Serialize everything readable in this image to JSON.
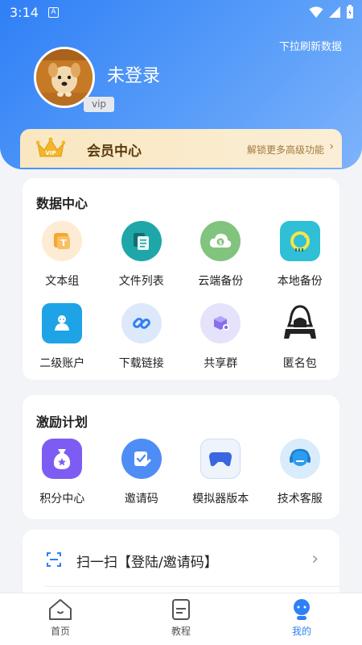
{
  "status": {
    "time": "3:14",
    "notify": "A"
  },
  "header": {
    "refresh_hint": "下拉刷新数据",
    "username": "未登录",
    "vip_tag": "vip"
  },
  "member": {
    "crown_text": "VIP",
    "title": "会员中心",
    "subtitle": "解锁更多高级功能",
    "chevron": "›"
  },
  "data_center": {
    "title": "数据中心",
    "items": [
      {
        "label": "文本组",
        "icon": "text-group-icon"
      },
      {
        "label": "文件列表",
        "icon": "file-list-icon"
      },
      {
        "label": "云端备份",
        "icon": "cloud-backup-icon"
      },
      {
        "label": "本地备份",
        "icon": "local-backup-icon"
      },
      {
        "label": "二级账户",
        "icon": "sub-account-icon"
      },
      {
        "label": "下载链接",
        "icon": "download-link-icon"
      },
      {
        "label": "共享群",
        "icon": "share-group-icon"
      },
      {
        "label": "匿名包",
        "icon": "anonymous-package-icon"
      }
    ]
  },
  "incentive": {
    "title": "激励计划",
    "items": [
      {
        "label": "积分中心",
        "icon": "points-center-icon"
      },
      {
        "label": "邀请码",
        "icon": "invite-code-icon"
      },
      {
        "label": "模拟器版本",
        "icon": "emulator-version-icon"
      },
      {
        "label": "技术客服",
        "icon": "tech-support-icon"
      }
    ]
  },
  "scan": {
    "label": "扫一扫【登陆/邀请码】",
    "chevron": "›"
  },
  "tabs": [
    {
      "label": "首页",
      "icon": "home-icon",
      "active": false
    },
    {
      "label": "教程",
      "icon": "tutorial-icon",
      "active": false
    },
    {
      "label": "我的",
      "icon": "profile-icon",
      "active": true
    }
  ],
  "colors": {
    "primary": "#2f7ff6",
    "member_bg": "#f9e7c0",
    "page_bg": "#f3f4f8"
  }
}
